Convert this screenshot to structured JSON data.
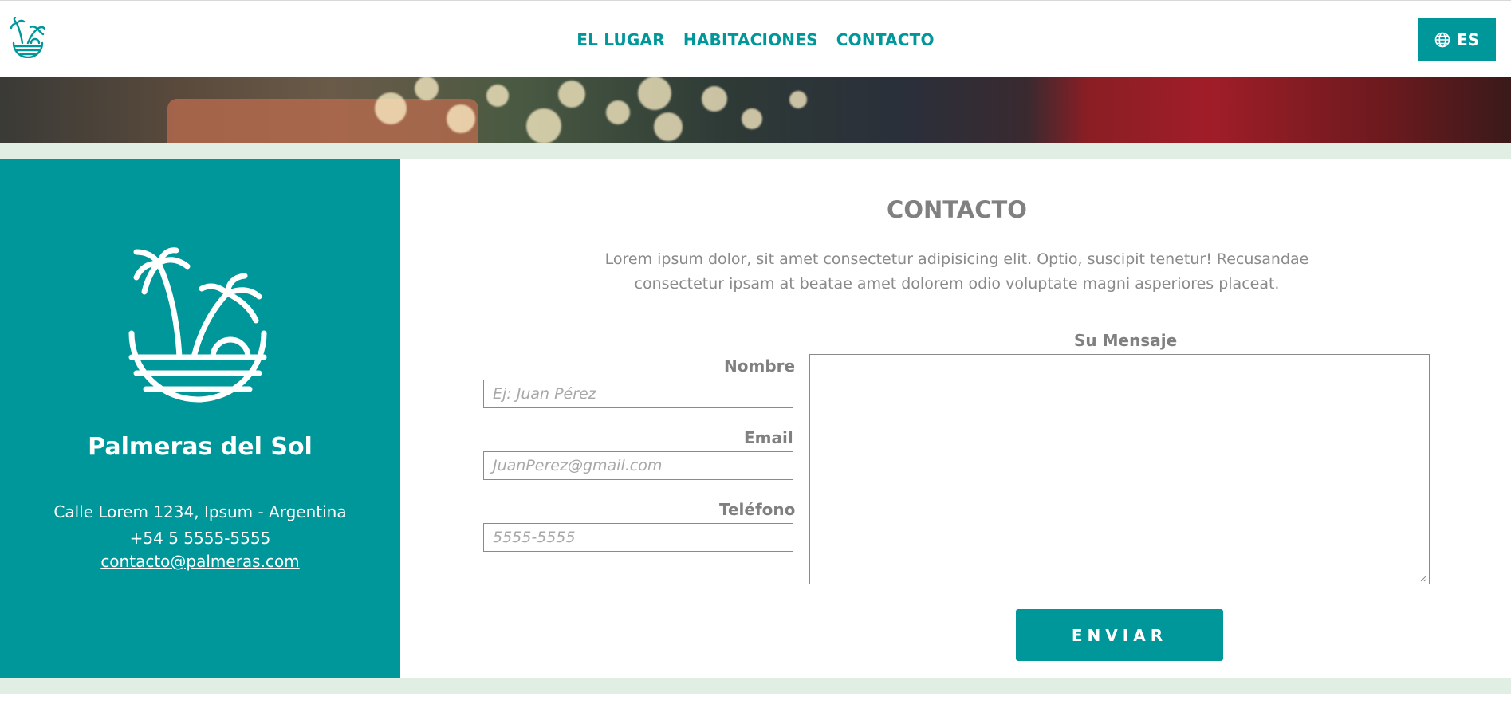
{
  "header": {
    "nav": [
      "EL LUGAR",
      "HABITACIONES",
      "CONTACTO"
    ],
    "lang_label": "ES",
    "lang_icon": "globe-icon",
    "logo_icon": "palm-logo-icon"
  },
  "sidebar": {
    "brand_name": "Palmeras del Sol",
    "address": "Calle Lorem 1234, Ipsum - Argentina",
    "phone": "+54 5 5555-5555",
    "email": "contacto@palmeras.com",
    "logo_icon": "palm-logo-icon"
  },
  "contact": {
    "title": "CONTACTO",
    "description_line1": "Lorem ipsum dolor, sit amet consectetur adipisicing elit. Optio, suscipit tenetur! Recusandae",
    "description_line2": "consectetur ipsam at beatae amet dolorem odio voluptate magni asperiores placeat.",
    "name_label": "Nombre",
    "name_placeholder": "Ej: Juan Pérez",
    "email_label": "Email",
    "email_placeholder": "JuanPerez@gmail.com",
    "phone_label": "Teléfono",
    "phone_placeholder": "5555-5555",
    "message_label": "Su Mensaje",
    "message_value": "",
    "submit_label": "ENVIAR"
  },
  "colors": {
    "brand": "#00979a",
    "band": "#e1eee4",
    "text_gray": "#808080"
  }
}
